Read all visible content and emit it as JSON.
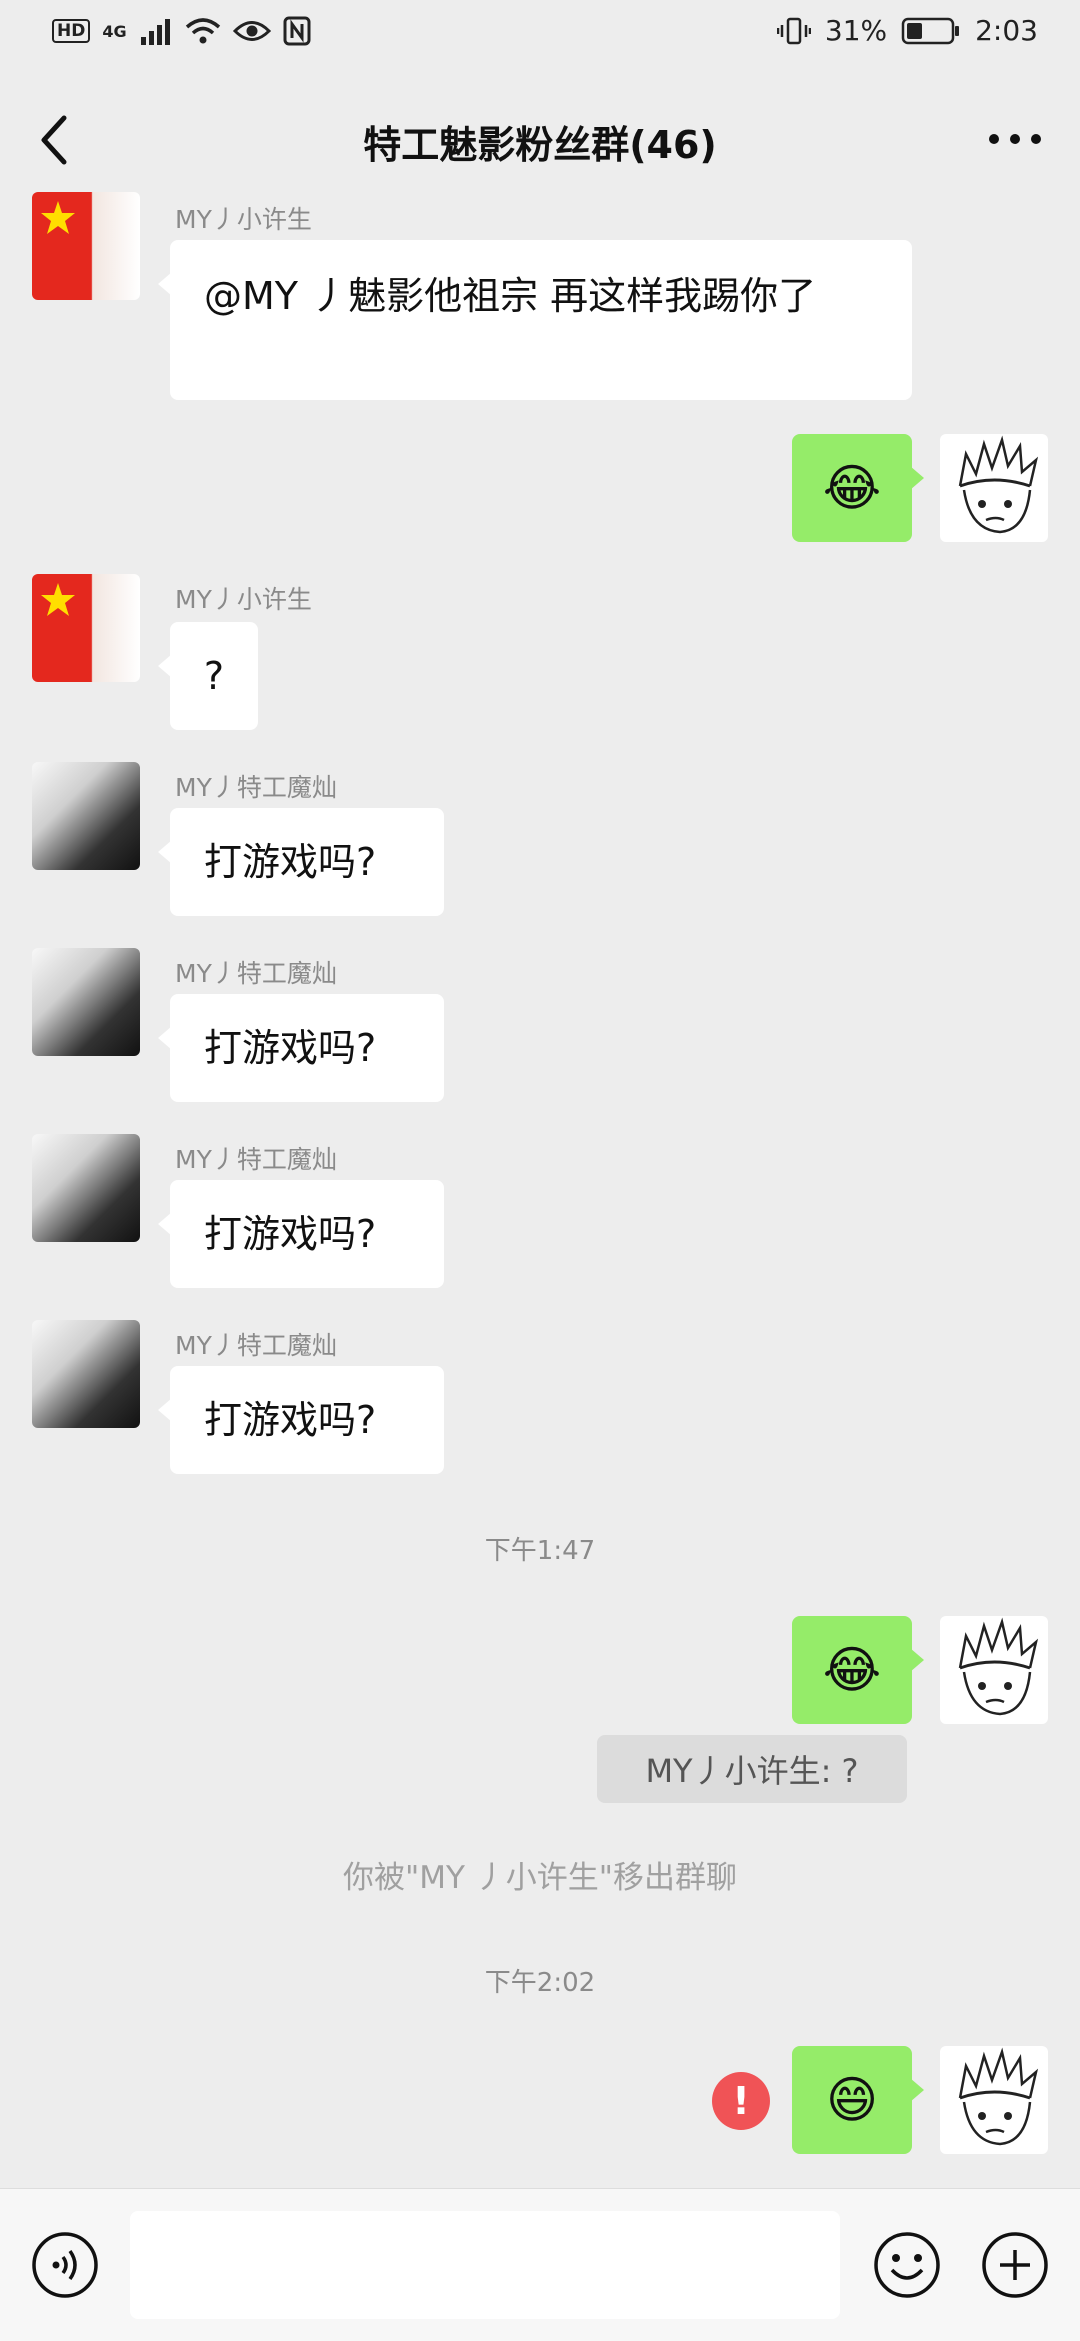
{
  "status_bar": {
    "hd": "HD",
    "network": "4G",
    "battery": "31%",
    "time": "2:03"
  },
  "header": {
    "title": "特工魅影粉丝群(46)"
  },
  "messages": {
    "m1": {
      "sender": "MY丿小许生",
      "text": "@MY 丿魅影他祖宗  再这样我踢你了"
    },
    "m2": {
      "emoji": "😂"
    },
    "m3": {
      "sender": "MY丿小许生",
      "text": "?"
    },
    "m4": {
      "sender": "MY丿特工魔灿",
      "text": "打游戏吗?"
    },
    "m5": {
      "sender": "MY丿特工魔灿",
      "text": "打游戏吗?"
    },
    "m6": {
      "sender": "MY丿特工魔灿",
      "text": "打游戏吗?"
    },
    "m7": {
      "sender": "MY丿特工魔灿",
      "text": "打游戏吗?"
    },
    "time1": "下午1:47",
    "m8": {
      "emoji": "😂"
    },
    "quote": "MY丿小许生: ?",
    "system_notice": "你被\"MY 丿小许生\"移出群聊",
    "time2": "下午2:02",
    "m9": {
      "emoji": "😄",
      "failed_mark": "!"
    }
  },
  "input_bar": {
    "value": ""
  },
  "icons": {
    "back": "chevron-left-icon",
    "more": "more-horizontal-icon",
    "voice": "voice-icon",
    "emoji": "smiley-icon",
    "plus": "plus-circle-icon",
    "failed": "exclamation-icon"
  },
  "colors": {
    "background": "#ededed",
    "bubble_self": "#95ec69",
    "bubble_other": "#ffffff",
    "error": "#f05356"
  }
}
